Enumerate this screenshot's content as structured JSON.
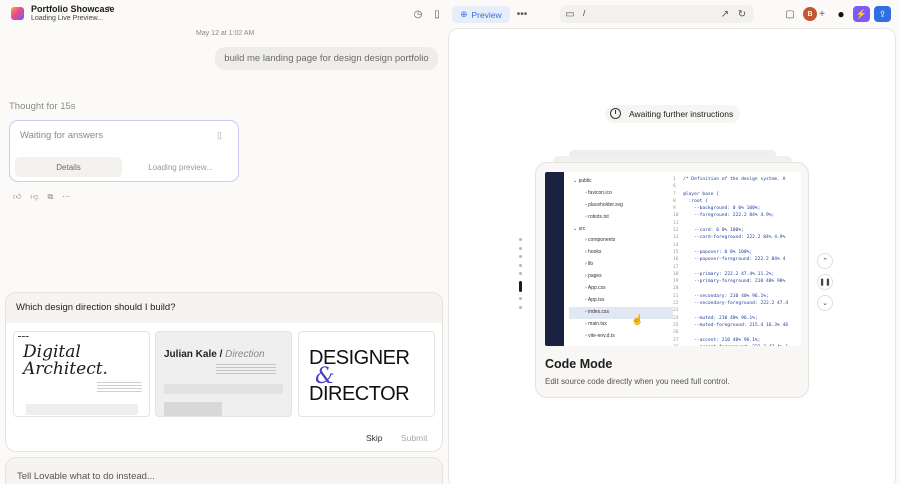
{
  "header": {
    "project_name": "Portfolio Showcase",
    "status": "Loading Live Preview...",
    "preview_label": "Preview",
    "url_path": "/",
    "avatar_initial": "B",
    "accent_color": "#7c5cf5",
    "preview_color": "#2f6fe0"
  },
  "chat": {
    "timestamp": "May 12 at 1:02 AM",
    "user_message": "build me landing page for design design portfolio",
    "thought": "Thought for 15s",
    "waiting_title": "Waiting for answers",
    "tab_details": "Details",
    "tab_loading": "Loading preview..."
  },
  "question": {
    "text": "Which design direction should I build?",
    "options": [
      {
        "title_line1": "Digital",
        "title_line2": "Architect."
      },
      {
        "title_main": "Julian Kale / ",
        "title_sub": "Direction"
      },
      {
        "line1": "DESIGNER",
        "amp": "&",
        "line2": "DIRECTOR"
      }
    ],
    "skip_label": "Skip",
    "submit_label": "Submit"
  },
  "input": {
    "placeholder": "Tell Lovable what to do instead..."
  },
  "preview": {
    "awaiting": "Awaiting further instructions",
    "mode_title": "Code Mode",
    "mode_desc": "Edit source code directly when you need full control.",
    "file_tree": [
      "public",
      "favicon.ico",
      "placeholder.svg",
      "robots.txt",
      "src",
      "components",
      "hooks",
      "lib",
      "pages",
      "App.css",
      "App.tsx",
      "index.css",
      "main.tsx",
      "vite-env.d.ts"
    ],
    "code_lines": [
      [
        "1",
        "/* Definition of the design system. A"
      ],
      [
        "6",
        ""
      ],
      [
        "7",
        "@layer base {"
      ],
      [
        "8",
        "  :root {"
      ],
      [
        "9",
        "    --background: 0 0% 100%;"
      ],
      [
        "10",
        "    --foreground: 222.2 84% 4.9%;"
      ],
      [
        "11",
        ""
      ],
      [
        "12",
        "    --card: 0 0% 100%;"
      ],
      [
        "13",
        "    --card-foreground: 222.2 84% 4.9%"
      ],
      [
        "14",
        ""
      ],
      [
        "15",
        "    --popover: 0 0% 100%;"
      ],
      [
        "16",
        "    --popover-foreground: 222.2 84% 4"
      ],
      [
        "17",
        ""
      ],
      [
        "18",
        "    --primary: 222.2 47.4% 11.2%;"
      ],
      [
        "19",
        "    --primary-foreground: 210 40% 98%"
      ],
      [
        "20",
        ""
      ],
      [
        "21",
        "    --secondary: 210 40% 96.1%;"
      ],
      [
        "22",
        "    --secondary-foreground: 222.2 47.4"
      ],
      [
        "23",
        ""
      ],
      [
        "24",
        "    --muted: 210 40% 96.1%;"
      ],
      [
        "25",
        "    --muted-foreground: 215.4 16.3% 46"
      ],
      [
        "26",
        ""
      ],
      [
        "27",
        "    --accent: 210 40% 96.1%;"
      ],
      [
        "28",
        "    --accent-foreground: 222.2 47.4% 1"
      ]
    ]
  }
}
